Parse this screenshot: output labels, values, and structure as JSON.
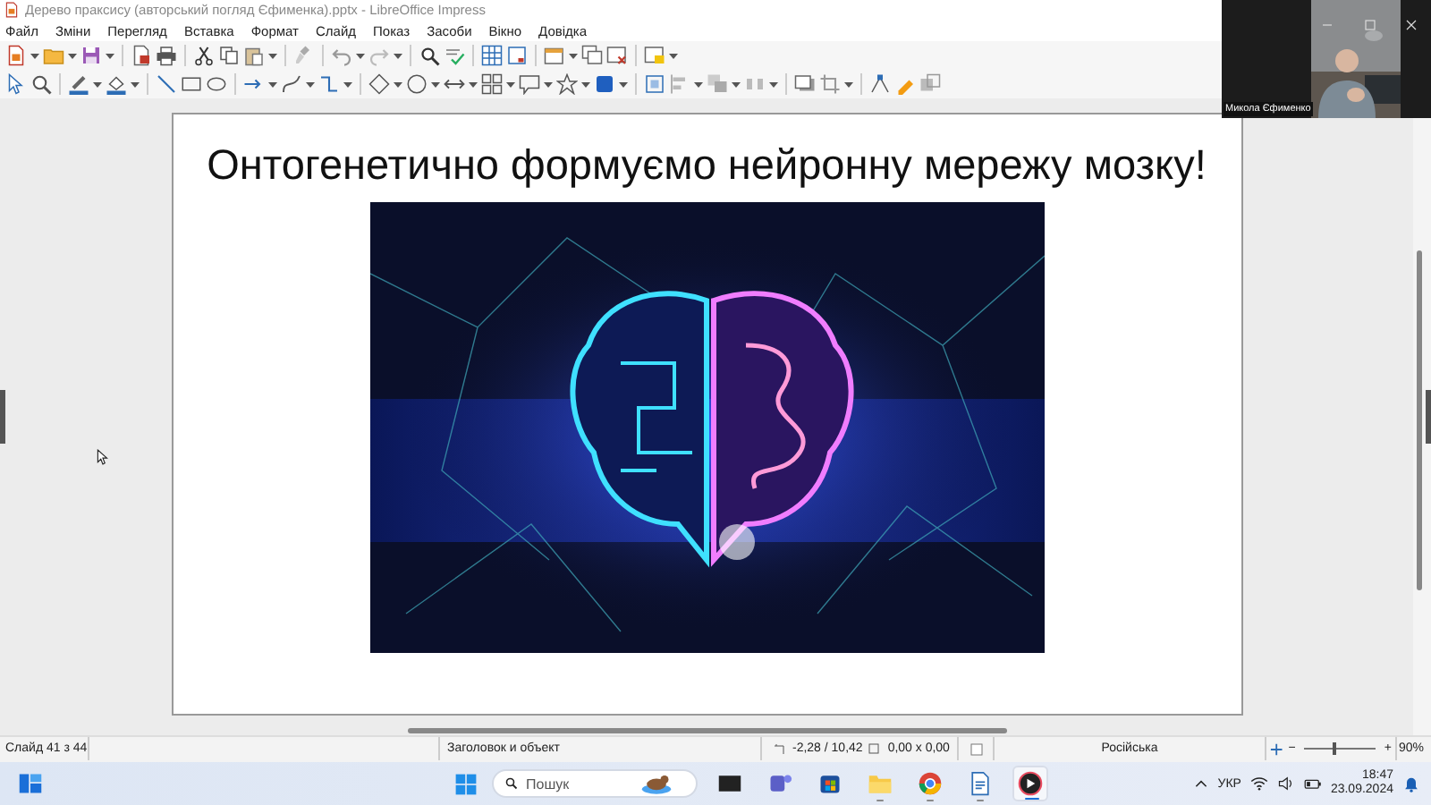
{
  "window": {
    "title": "Дерево праксису (авторський погляд Єфименка).pptx - LibreOffice Impress"
  },
  "menu": [
    "Файл",
    "Зміни",
    "Перегляд",
    "Вставка",
    "Формат",
    "Слайд",
    "Показ",
    "Засоби",
    "Вікно",
    "Довідка"
  ],
  "slide": {
    "title": "Онтогенетично формуємо нейронну мережу мозку!"
  },
  "status_bar": {
    "slide": "Слайд 41 з 44",
    "layout": "Заголовок и объект",
    "position": "-2,28 / 10,42",
    "size": "0,00 x 0,00",
    "language": "Російська",
    "zoom_out": "−",
    "zoom_in": "+",
    "zoom": {
      "level": 0.4
    },
    "zoom_percent": "90%"
  },
  "video_call": {
    "participant": "Микола Єфименко"
  },
  "taskbar": {
    "search": {
      "placeholder": "Пошук"
    },
    "apps": [
      {
        "kind": "taskview",
        "running": false,
        "selected": false
      },
      {
        "kind": "teams",
        "running": false,
        "selected": false
      },
      {
        "kind": "store",
        "running": false,
        "selected": false
      },
      {
        "kind": "files",
        "running": true,
        "selected": false
      },
      {
        "kind": "browser",
        "running": true,
        "selected": false
      },
      {
        "kind": "writer",
        "running": true,
        "selected": false
      },
      {
        "kind": "player",
        "running": true,
        "selected": true
      }
    ],
    "language": "УКР",
    "time": "18:47",
    "date": "23.09.2024"
  }
}
